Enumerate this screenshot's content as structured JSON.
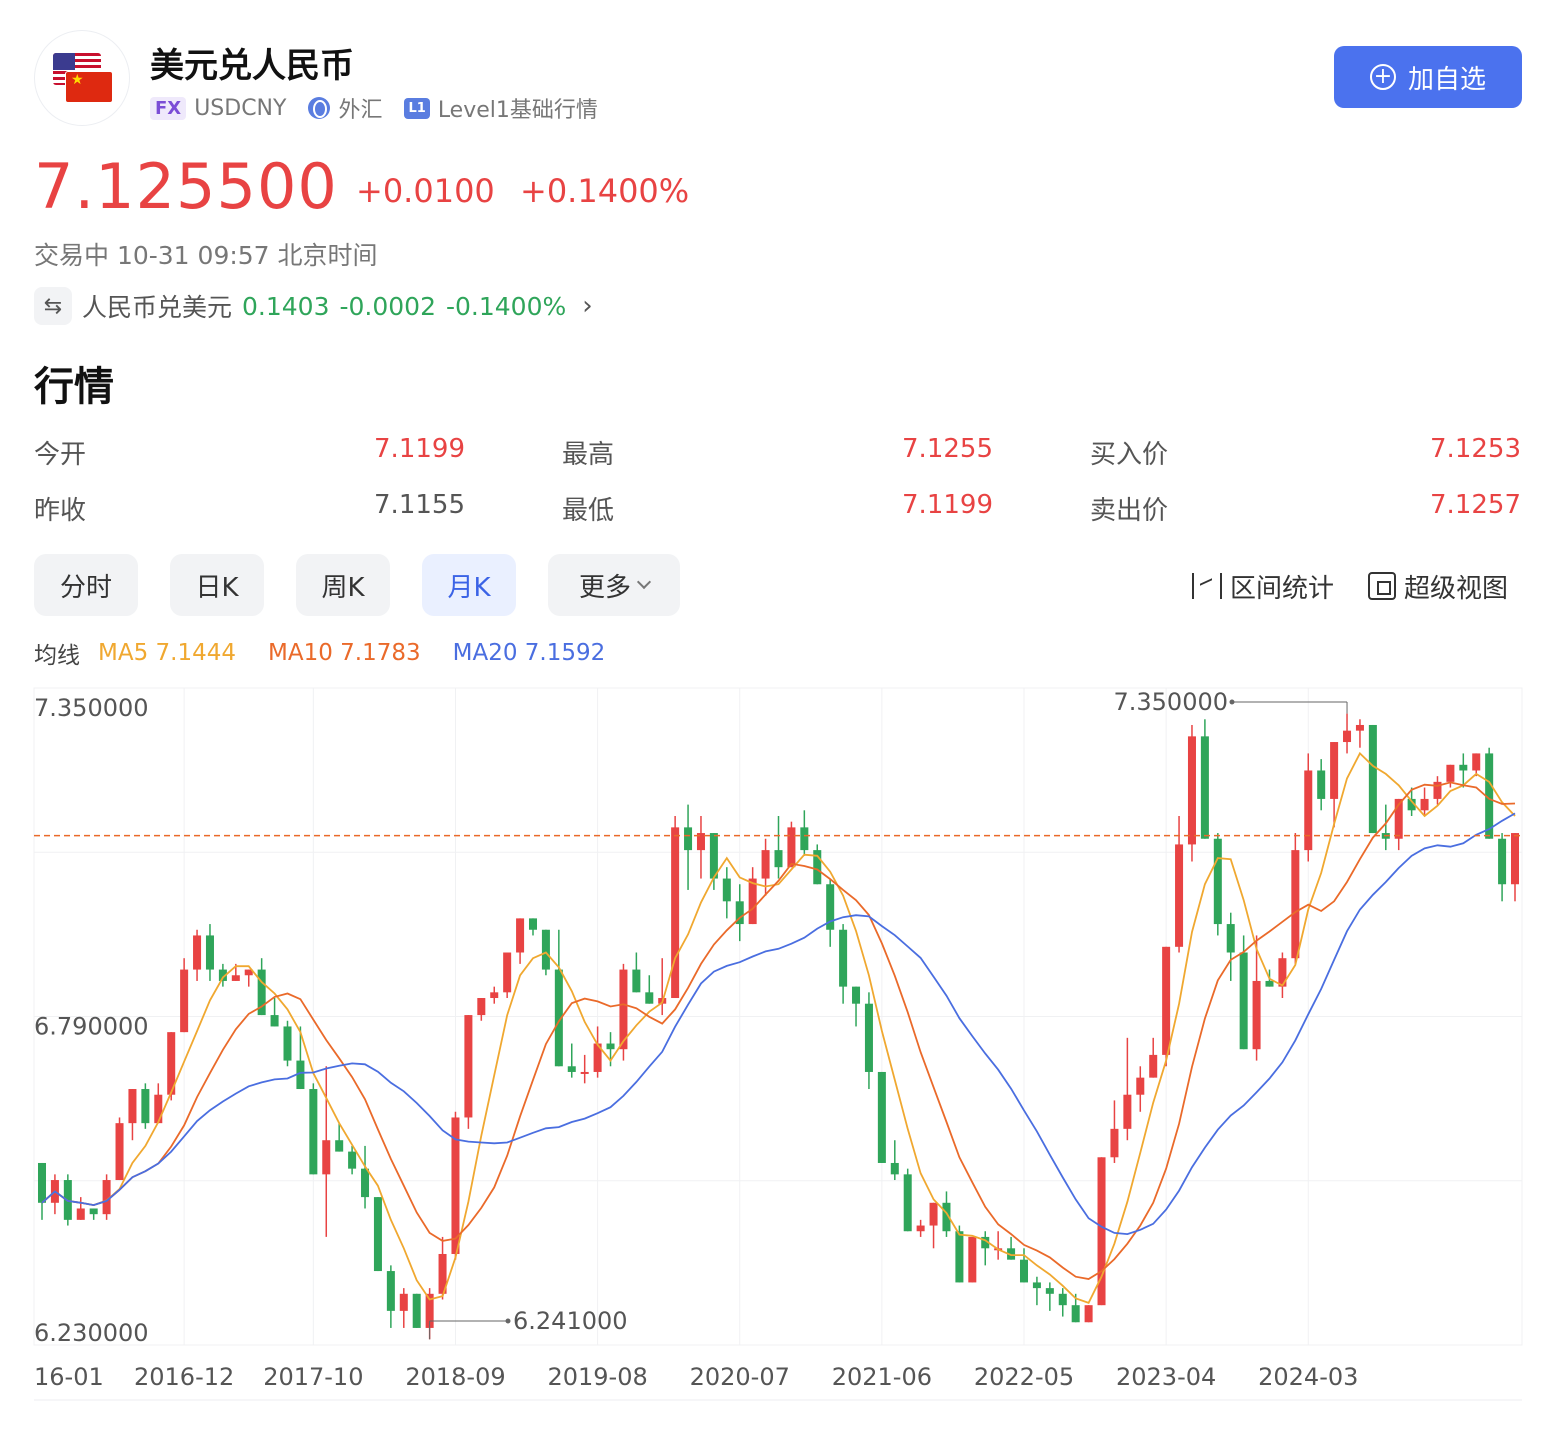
{
  "header": {
    "title": "美元兑人民币",
    "fx_badge": "FX",
    "symbol": "USDCNY",
    "market": "外汇",
    "level_badge": "L1",
    "level_text": "Level1基础行情",
    "add_label": "加自选"
  },
  "quote": {
    "price": "7.125500",
    "change": "+0.0100",
    "change_pct": "+0.1400%",
    "status": "交易中 10-31 09:57 北京时间"
  },
  "reverse_pair": {
    "name": "人民币兑美元",
    "price": "0.1403",
    "change": "-0.0002",
    "change_pct": "-0.1400%"
  },
  "section_title": "行情",
  "stats": [
    {
      "label": "今开",
      "value": "7.1199"
    },
    {
      "label": "最高",
      "value": "7.1255"
    },
    {
      "label": "买入价",
      "value": "7.1253"
    },
    {
      "label": "昨收",
      "value": "7.1155"
    },
    {
      "label": "最低",
      "value": "7.1199"
    },
    {
      "label": "卖出价",
      "value": "7.1257"
    }
  ],
  "tabs": [
    {
      "label": "分时"
    },
    {
      "label": "日K"
    },
    {
      "label": "周K"
    },
    {
      "label": "月K"
    },
    {
      "label": "更多"
    }
  ],
  "tools": {
    "range": "区间统计",
    "super": "超级视图"
  },
  "ma": {
    "label": "均线",
    "ma5": "MA5 7.1444",
    "ma10": "MA10 7.1783",
    "ma20": "MA20 7.1592"
  },
  "colors": {
    "up": "#e84343",
    "down": "#2fa55a",
    "ma5": "#f0a830",
    "ma10": "#ea6a2a",
    "ma20": "#4a6ee0",
    "accent": "#4b72ee"
  },
  "chart_data": {
    "type": "candlestick",
    "period": "monthly",
    "y_ticks": [
      "7.350000",
      "6.790000",
      "6.230000"
    ],
    "x_ticks": [
      "16-01",
      "2016-12",
      "2017-10",
      "2018-09",
      "2019-08",
      "2020-07",
      "2021-06",
      "2022-05",
      "2023-04",
      "2024-03"
    ],
    "ylim": [
      6.23,
      7.385
    ],
    "current_price": 7.1255,
    "max_label": "7.350000",
    "min_label": "6.241000",
    "candles": [
      [
        6.55,
        6.55,
        6.45,
        6.48
      ],
      [
        6.48,
        6.53,
        6.46,
        6.52
      ],
      [
        6.52,
        6.53,
        6.44,
        6.45
      ],
      [
        6.45,
        6.49,
        6.45,
        6.47
      ],
      [
        6.47,
        6.47,
        6.45,
        6.46
      ],
      [
        6.46,
        6.53,
        6.45,
        6.52
      ],
      [
        6.52,
        6.63,
        6.52,
        6.62
      ],
      [
        6.62,
        6.67,
        6.59,
        6.68
      ],
      [
        6.68,
        6.69,
        6.61,
        6.62
      ],
      [
        6.62,
        6.69,
        6.62,
        6.67
      ],
      [
        6.67,
        6.78,
        6.66,
        6.78
      ],
      [
        6.78,
        6.91,
        6.78,
        6.89
      ],
      [
        6.89,
        6.96,
        6.87,
        6.95
      ],
      [
        6.95,
        6.97,
        6.87,
        6.89
      ],
      [
        6.89,
        6.9,
        6.86,
        6.87
      ],
      [
        6.87,
        6.9,
        6.87,
        6.88
      ],
      [
        6.88,
        6.89,
        6.86,
        6.89
      ],
      [
        6.89,
        6.91,
        6.87,
        6.81
      ],
      [
        6.81,
        6.84,
        6.79,
        6.79
      ],
      [
        6.79,
        6.8,
        6.72,
        6.73
      ],
      [
        6.73,
        6.79,
        6.72,
        6.68
      ],
      [
        6.68,
        6.69,
        6.53,
        6.53
      ],
      [
        6.53,
        6.72,
        6.42,
        6.59
      ],
      [
        6.59,
        6.62,
        6.58,
        6.57
      ],
      [
        6.57,
        6.58,
        6.53,
        6.54
      ],
      [
        6.54,
        6.58,
        6.47,
        6.49
      ],
      [
        6.49,
        6.46,
        6.48,
        6.36
      ],
      [
        6.36,
        6.37,
        6.26,
        6.29
      ],
      [
        6.29,
        6.33,
        6.26,
        6.32
      ],
      [
        6.32,
        6.32,
        6.26,
        6.26
      ],
      [
        6.26,
        6.33,
        6.24,
        6.32
      ],
      [
        6.32,
        6.42,
        6.31,
        6.39
      ],
      [
        6.39,
        6.64,
        6.38,
        6.63
      ],
      [
        6.63,
        6.81,
        6.61,
        6.81
      ],
      [
        6.81,
        6.83,
        6.8,
        6.84
      ],
      [
        6.84,
        6.86,
        6.83,
        6.85
      ],
      [
        6.85,
        6.88,
        6.84,
        6.92
      ],
      [
        6.92,
        6.98,
        6.9,
        6.98
      ],
      [
        6.98,
        6.97,
        6.95,
        6.96
      ],
      [
        6.96,
        6.96,
        6.88,
        6.89
      ],
      [
        6.89,
        6.96,
        6.86,
        6.72
      ],
      [
        6.72,
        6.76,
        6.7,
        6.71
      ],
      [
        6.71,
        6.74,
        6.69,
        6.71
      ],
      [
        6.71,
        6.79,
        6.7,
        6.76
      ],
      [
        6.76,
        6.78,
        6.72,
        6.75
      ],
      [
        6.75,
        6.9,
        6.73,
        6.89
      ],
      [
        6.89,
        6.92,
        6.87,
        6.85
      ],
      [
        6.85,
        6.88,
        6.84,
        6.83
      ],
      [
        6.83,
        6.91,
        6.81,
        6.84
      ],
      [
        6.84,
        7.16,
        6.86,
        7.14
      ],
      [
        7.14,
        7.18,
        7.03,
        7.1
      ],
      [
        7.1,
        7.16,
        7.05,
        7.13
      ],
      [
        7.13,
        7.13,
        7.03,
        7.05
      ],
      [
        7.05,
        7.07,
        6.98,
        7.01
      ],
      [
        7.01,
        7.04,
        6.94,
        6.97
      ],
      [
        6.97,
        7.07,
        6.97,
        7.05
      ],
      [
        7.05,
        7.12,
        7.02,
        7.1
      ],
      [
        7.1,
        7.16,
        7.05,
        7.07
      ],
      [
        7.07,
        7.15,
        7.07,
        7.14
      ],
      [
        7.14,
        7.17,
        7.09,
        7.1
      ],
      [
        7.1,
        7.11,
        7.05,
        7.04
      ],
      [
        7.04,
        7.05,
        6.93,
        6.96
      ],
      [
        6.96,
        6.97,
        6.83,
        6.86
      ],
      [
        6.86,
        6.85,
        6.79,
        6.83
      ],
      [
        6.83,
        6.85,
        6.68,
        6.71
      ],
      [
        6.71,
        6.71,
        6.55,
        6.55
      ],
      [
        6.55,
        6.59,
        6.52,
        6.53
      ],
      [
        6.53,
        6.54,
        6.44,
        6.43
      ],
      [
        6.43,
        6.45,
        6.42,
        6.44
      ],
      [
        6.44,
        6.47,
        6.4,
        6.48
      ],
      [
        6.48,
        6.5,
        6.42,
        6.43
      ],
      [
        6.43,
        6.44,
        6.34,
        6.34
      ],
      [
        6.34,
        6.42,
        6.34,
        6.42
      ],
      [
        6.42,
        6.43,
        6.37,
        6.4
      ],
      [
        6.4,
        6.43,
        6.38,
        6.4
      ],
      [
        6.4,
        6.42,
        6.38,
        6.38
      ],
      [
        6.38,
        6.4,
        6.34,
        6.34
      ],
      [
        6.34,
        6.35,
        6.3,
        6.33
      ],
      [
        6.33,
        6.34,
        6.29,
        6.32
      ],
      [
        6.32,
        6.33,
        6.28,
        6.3
      ],
      [
        6.3,
        6.32,
        6.27,
        6.27
      ],
      [
        6.27,
        6.3,
        6.27,
        6.3
      ],
      [
        6.3,
        6.36,
        6.3,
        6.56
      ],
      [
        6.56,
        6.66,
        6.55,
        6.61
      ],
      [
        6.61,
        6.77,
        6.59,
        6.67
      ],
      [
        6.67,
        6.72,
        6.64,
        6.7
      ],
      [
        6.7,
        6.77,
        6.7,
        6.74
      ],
      [
        6.74,
        6.86,
        6.72,
        6.93
      ],
      [
        6.93,
        7.16,
        6.92,
        7.11
      ],
      [
        7.11,
        7.32,
        7.08,
        7.3
      ],
      [
        7.3,
        7.33,
        7.15,
        7.12
      ],
      [
        7.12,
        7.13,
        6.95,
        6.97
      ],
      [
        6.97,
        6.99,
        6.87,
        6.92
      ],
      [
        6.92,
        6.95,
        6.84,
        6.75
      ],
      [
        6.75,
        6.95,
        6.73,
        6.87
      ],
      [
        6.87,
        6.89,
        6.86,
        6.86
      ],
      [
        6.86,
        6.92,
        6.84,
        6.91
      ],
      [
        6.91,
        7.13,
        6.9,
        7.1
      ],
      [
        7.1,
        7.27,
        7.08,
        7.24
      ],
      [
        7.24,
        7.26,
        7.17,
        7.19
      ],
      [
        7.19,
        7.28,
        7.14,
        7.29
      ],
      [
        7.29,
        7.34,
        7.27,
        7.31
      ],
      [
        7.31,
        7.33,
        7.28,
        7.32
      ],
      [
        7.32,
        7.32,
        7.17,
        7.13
      ],
      [
        7.13,
        7.18,
        7.1,
        7.12
      ],
      [
        7.12,
        7.17,
        7.1,
        7.19
      ],
      [
        7.19,
        7.21,
        7.16,
        7.17
      ],
      [
        7.17,
        7.21,
        7.16,
        7.19
      ],
      [
        7.19,
        7.23,
        7.18,
        7.22
      ],
      [
        7.22,
        7.24,
        7.21,
        7.25
      ],
      [
        7.25,
        7.27,
        7.21,
        7.24
      ],
      [
        7.24,
        7.27,
        7.23,
        7.27
      ],
      [
        7.27,
        7.28,
        7.12,
        7.12
      ],
      [
        7.12,
        7.13,
        7.01,
        7.04
      ],
      [
        7.04,
        7.11,
        7.01,
        7.13
      ]
    ]
  }
}
